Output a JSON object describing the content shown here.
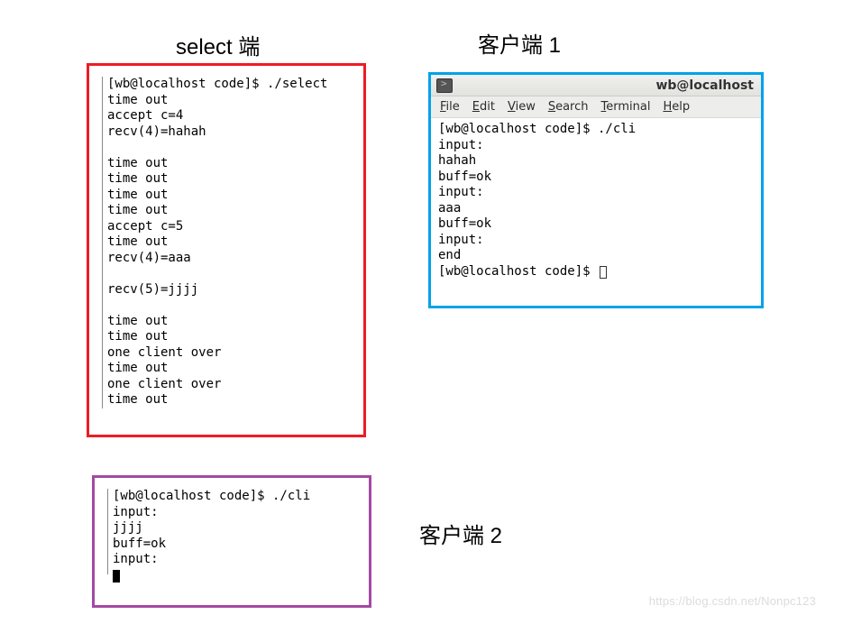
{
  "headings": {
    "select": "select 端",
    "client1": "客户端 1",
    "client2": "客户端 2"
  },
  "select_terminal": {
    "lines": "[wb@localhost code]$ ./select\ntime out\naccept c=4\nrecv(4)=hahah\n\ntime out\ntime out\ntime out\ntime out\naccept c=5\ntime out\nrecv(4)=aaa\n\nrecv(5)=jjjj\n\ntime out\ntime out\none client over\ntime out\none client over\ntime out"
  },
  "client1_terminal": {
    "title": "wb@localhost",
    "menu": {
      "file": "File",
      "edit": "Edit",
      "view": "View",
      "search": "Search",
      "terminal": "Terminal",
      "help": "Help"
    },
    "lines": "[wb@localhost code]$ ./cli\ninput:\nhahah\nbuff=ok\ninput:\naaa\nbuff=ok\ninput:\nend\n[wb@localhost code]$ "
  },
  "client2_terminal": {
    "lines": "[wb@localhost code]$ ./cli\ninput:\njjjj\nbuff=ok\ninput:"
  },
  "watermark": "https://blog.csdn.net/Nonpc123"
}
